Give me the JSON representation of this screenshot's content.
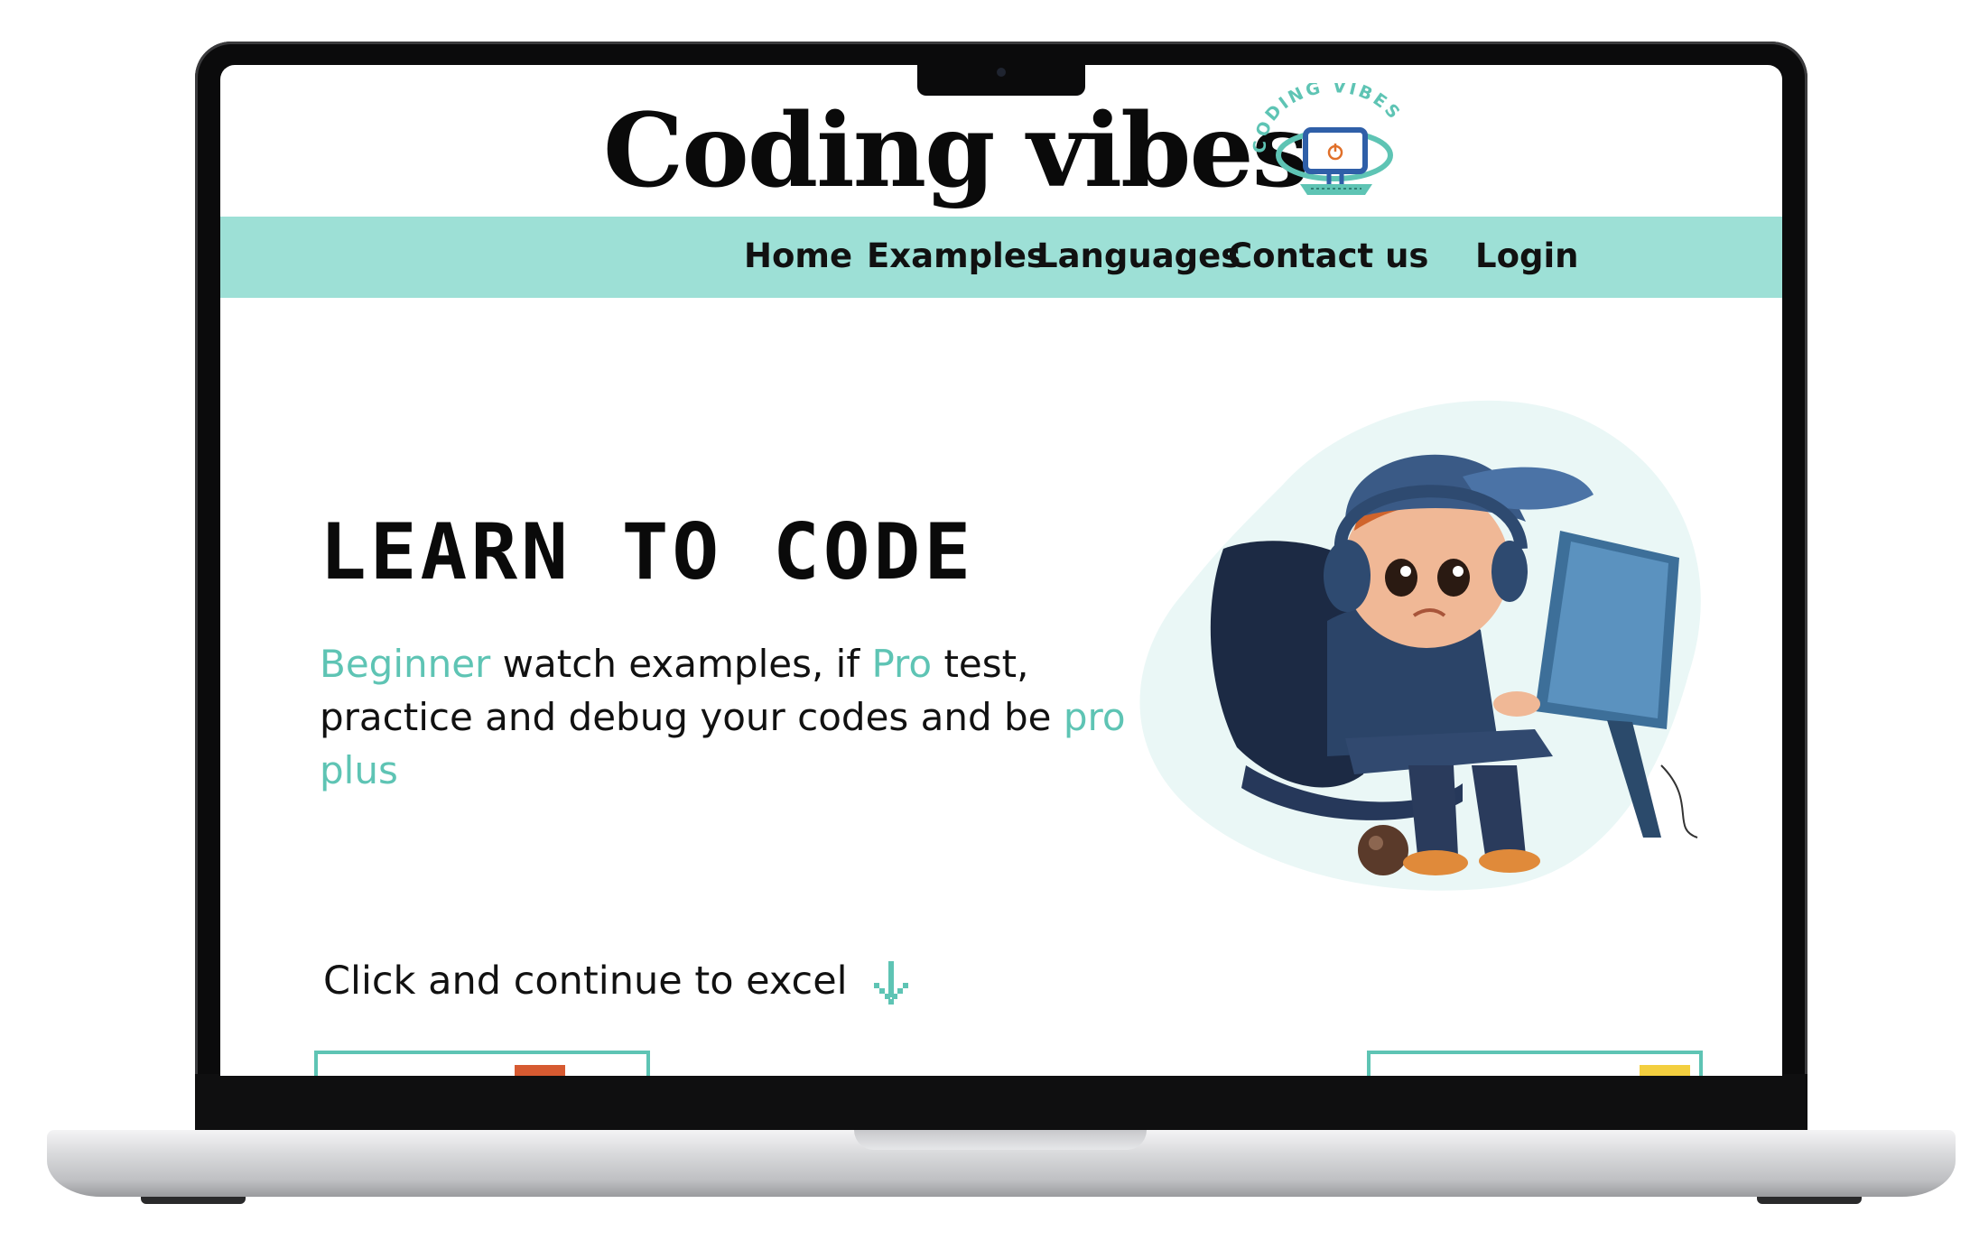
{
  "brand": {
    "title": "Coding vibes",
    "logo_text": "CODING VIBES",
    "logo_icon": "monitor-power-icon"
  },
  "nav": {
    "items": [
      {
        "label": "Home"
      },
      {
        "label": "Examples"
      },
      {
        "label": "Languages"
      },
      {
        "label": "Contact us"
      },
      {
        "label": "Login"
      }
    ]
  },
  "hero": {
    "title": "LEARN TO CODE",
    "text_parts": [
      {
        "text": "Beginner",
        "accent": true
      },
      {
        "text": " watch examples, if ",
        "accent": false
      },
      {
        "text": "Pro",
        "accent": true
      },
      {
        "text": " test, practice and debug your codes and be ",
        "accent": false
      },
      {
        "text": "pro plus",
        "accent": true
      }
    ],
    "illustration": "boy-with-headphones-at-computer"
  },
  "cta": {
    "label": "Click and continue to excel",
    "icon": "arrow-down-icon"
  },
  "colors": {
    "accent": "#5ec4b4",
    "nav_background": "#9de0d6",
    "blob": "#eaf7f6",
    "card_chip_left": "#d65a31",
    "card_chip_right": "#f3cf3f"
  }
}
